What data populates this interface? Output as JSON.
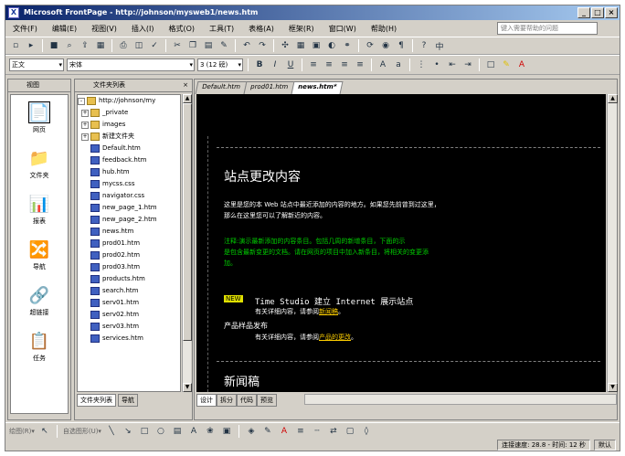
{
  "window": {
    "title": "Microsoft FrontPage - http://johnson/mysweb1/news.htm",
    "help_placeholder": "键入需要帮助的问题"
  },
  "menu": [
    "文件(F)",
    "编辑(E)",
    "视图(V)",
    "插入(I)",
    "格式(O)",
    "工具(T)",
    "表格(A)",
    "框架(R)",
    "窗口(W)",
    "帮助(H)"
  ],
  "format_bar": {
    "style": "正文",
    "font": "宋体",
    "size": "3 (12 磅)"
  },
  "views_pane": {
    "title": "视图",
    "items": [
      {
        "label": "网页",
        "icon": "page-view-icon",
        "selected": true
      },
      {
        "label": "文件夹",
        "icon": "folders-view-icon"
      },
      {
        "label": "报表",
        "icon": "reports-view-icon"
      },
      {
        "label": "导航",
        "icon": "navigation-view-icon"
      },
      {
        "label": "超链接",
        "icon": "hyperlinks-view-icon"
      },
      {
        "label": "任务",
        "icon": "tasks-view-icon"
      }
    ]
  },
  "folder_list": {
    "title": "文件夹列表",
    "root": "http://johnson/my",
    "items": [
      {
        "name": "_private",
        "type": "folder"
      },
      {
        "name": "images",
        "type": "folder"
      },
      {
        "name": "新建文件夹",
        "type": "folder"
      },
      {
        "name": "Default.htm",
        "type": "page"
      },
      {
        "name": "feedback.htm",
        "type": "page"
      },
      {
        "name": "hub.htm",
        "type": "page"
      },
      {
        "name": "mycss.css",
        "type": "page"
      },
      {
        "name": "navigator.css",
        "type": "page"
      },
      {
        "name": "new_page_1.htm",
        "type": "page"
      },
      {
        "name": "new_page_2.htm",
        "type": "page"
      },
      {
        "name": "news.htm",
        "type": "page"
      },
      {
        "name": "prod01.htm",
        "type": "page"
      },
      {
        "name": "prod02.htm",
        "type": "page"
      },
      {
        "name": "prod03.htm",
        "type": "page"
      },
      {
        "name": "products.htm",
        "type": "page"
      },
      {
        "name": "search.htm",
        "type": "page"
      },
      {
        "name": "serv01.htm",
        "type": "page"
      },
      {
        "name": "serv02.htm",
        "type": "page"
      },
      {
        "name": "serv03.htm",
        "type": "page"
      },
      {
        "name": "services.htm",
        "type": "page"
      }
    ],
    "tabs": [
      "文件夹列表",
      "导航"
    ]
  },
  "doc_tabs": [
    "Default.htm",
    "prod01.htm",
    "news.htm*"
  ],
  "content": {
    "heading": "站点更改内容",
    "para1_line1": "这里是您的本 Web 站点中最近添加的内容的地方。如果您先前曾到过这里，",
    "para1_line2": "那么在这里您可以了解新近的内容。",
    "para2_line1": "注释:演示最新添加的内容条目。包括几周的新增条目，下面的示",
    "para2_line2": "是包含最新变更的文档。请在网页的项目中加入新条目，将相关的变更添",
    "para2_line3": "加。",
    "new_badge": "NEW",
    "item1_title": "Time Studio 建立 Internet 展示站点",
    "item1_desc_prefix": "有关详细内容，请参阅",
    "item1_link": "新闻稿",
    "item2_title": "产品样品发布",
    "item2_desc_prefix": "有关详细内容，请参阅",
    "item2_link": "产品的更改",
    "section2": "新闻稿"
  },
  "view_tabs": [
    "设计",
    "拆分",
    "代码",
    "预览"
  ],
  "status": {
    "connection": "连接速度: 28.8 - 时间: 12 秒",
    "mode": "默认"
  }
}
